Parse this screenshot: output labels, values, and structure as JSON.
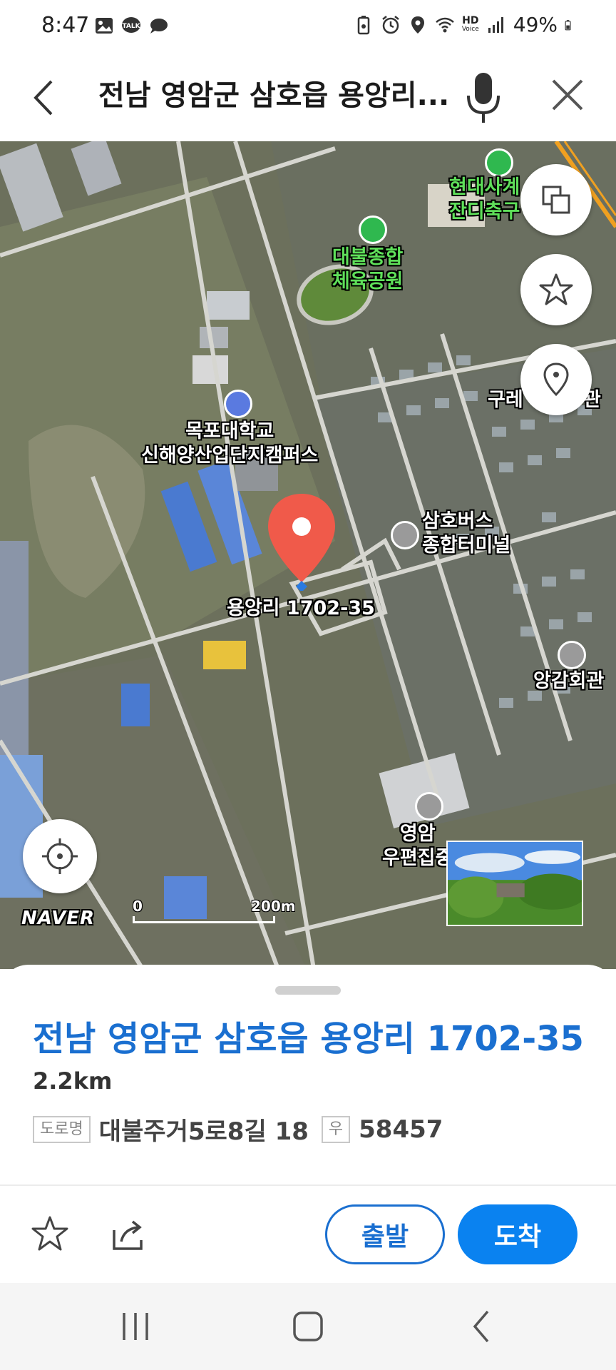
{
  "status_bar": {
    "time": "8:47",
    "battery": "49%",
    "left_icons": [
      "gallery-icon",
      "kakaotalk-icon",
      "chat-bubble-icon"
    ],
    "right_icons": [
      "battery-saver-icon",
      "alarm-icon",
      "location-icon",
      "wifi-icon",
      "hd-voice-icon",
      "signal-icon",
      "battery-icon"
    ],
    "hd_label": "HD",
    "voice_label": "Voice",
    "talk_label": "TALK"
  },
  "search": {
    "query": "전남 영암군 삼호읍 용앙리..."
  },
  "map": {
    "poi_labels": {
      "hyundai": "현대사계\n잔디축구",
      "daebul_park": "대불종합\n체육공원",
      "mokpo_univ": "목포대학교\n신해양산업단지캠퍼스",
      "bus_terminal": "삼호버스\n종합터미널",
      "gure": "구레",
      "gure_suffix": "관",
      "angam": "앙감회관",
      "post": "영암\n우편집중"
    },
    "pin_label": "용앙리 1702-35",
    "brand": "NAVER",
    "scale_zero": "0",
    "scale_max": "200m",
    "colors": {
      "pin": "#f05a4a",
      "green_label": "#5fe05a",
      "accent": "#1a6fd0"
    }
  },
  "place": {
    "name": "전남 영암군 삼호읍 용앙리 1702-35",
    "distance": "2.2km",
    "road_tag": "도로명",
    "road_address": "대불주거5로8길 18",
    "zip_tag": "우",
    "zip": "58457"
  },
  "actions": {
    "depart": "출발",
    "arrive": "도착"
  }
}
